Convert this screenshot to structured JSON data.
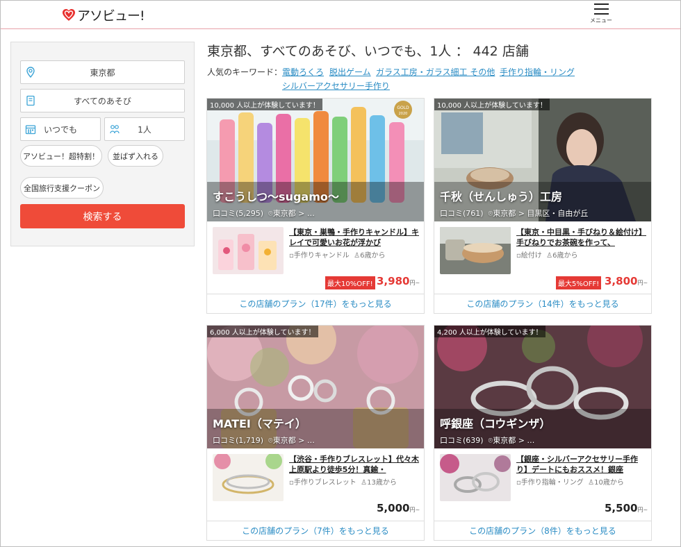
{
  "header": {
    "logo_text": "アソビュー!",
    "menu_label": "メニュー"
  },
  "sidebar": {
    "location": "東京都",
    "category": "すべてのあそび",
    "date": "いつでも",
    "people": "1人",
    "chips": [
      "アソビュー！超特割！",
      "並ばず入れる",
      "全国旅行支援クーポン"
    ],
    "search_label": "検索する"
  },
  "main": {
    "title": "東京都、すべてのあそび、いつでも、1人 ： 442 店舗",
    "keywords_label": "人気のキーワード：",
    "keywords": [
      "電動ろくろ",
      "脱出ゲーム",
      "ガラス工房・ガラス細工 その他",
      "手作り指輪・リング",
      "シルバーアクセサリー手作り"
    ]
  },
  "cards": [
    {
      "badge": "10,000 人以上が体験しています！",
      "shop_name": "すこうしつ〜sugamo〜",
      "reviews": "口コミ(5,295)",
      "area": "東京都 > …",
      "plan_title": "【東京・巣鴨・手作りキャンドル】キレイで可愛いお花が浮かび",
      "plan_category": "手作りキャンドル",
      "plan_age": "6歳から",
      "discount": "最大10%OFF!",
      "price": "3,980",
      "price_unit": "円~",
      "more_link": "この店舗のプラン（17件）をもっと見る",
      "gold_label": "GOLD",
      "gold_year": "2020"
    },
    {
      "badge": "10,000 人以上が体験しています！",
      "shop_name": "千秋（せんしゅう）工房",
      "reviews": "口コミ(761)",
      "area": "東京都 > 目黒区・自由が丘",
      "plan_title": "【東京・中目黒・手びねり＆絵付け】手びねりでお茶碗を作って、",
      "plan_category": "絵付け",
      "plan_age": "6歳から",
      "discount": "最大5%OFF!",
      "price": "3,800",
      "price_unit": "円~",
      "more_link": "この店舗のプラン（14件）をもっと見る"
    },
    {
      "badge": "6,000 人以上が体験しています！",
      "shop_name": "MATEI（マテイ）",
      "reviews": "口コミ(1,719)",
      "area": "東京都 > …",
      "plan_title": "【渋谷・手作りブレスレット】代々木上原駅より徒歩5分！真鍮・",
      "plan_category": "手作りブレスレット",
      "plan_age": "13歳から",
      "discount": "",
      "price": "5,000",
      "price_unit": "円~",
      "more_link": "この店舗のプラン（7件）をもっと見る"
    },
    {
      "badge": "4,200 人以上が体験しています！",
      "shop_name": "呼銀座（コウギンザ）",
      "reviews": "口コミ(639)",
      "area": "東京都 > …",
      "plan_title": "【銀座・シルバーアクセサリー手作り】デートにもおススメ！銀座",
      "plan_category": "手作り指輪・リング",
      "plan_age": "10歳から",
      "discount": "",
      "price": "5,500",
      "price_unit": "円~",
      "more_link": "この店舗のプラン（8件）をもっと見る"
    }
  ]
}
